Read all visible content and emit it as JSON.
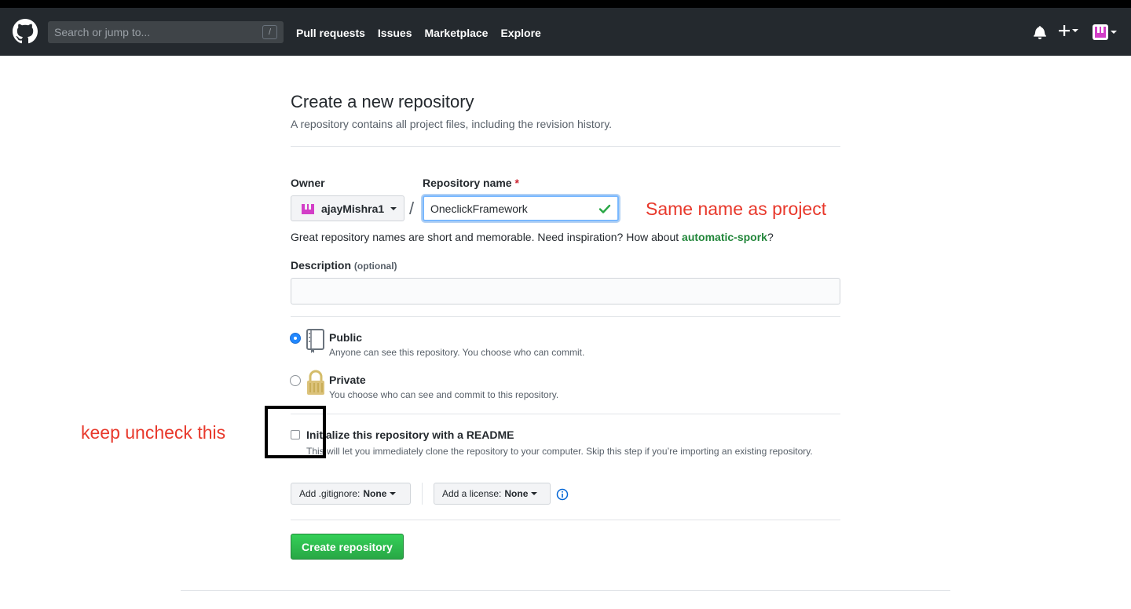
{
  "header": {
    "search_placeholder": "Search or jump to...",
    "search_shortcut": "/",
    "nav": [
      "Pull requests",
      "Issues",
      "Marketplace",
      "Explore"
    ],
    "plus_label": "+"
  },
  "page": {
    "title": "Create a new repository",
    "subtitle": "A repository contains all project files, including the revision history."
  },
  "form": {
    "owner_label": "Owner",
    "owner_value": "ajayMishra1",
    "slash": "/",
    "repo_label": "Repository name",
    "required_mark": "*",
    "repo_value": "OneclickFramework",
    "hint_prefix": "Great repository names are short and memorable. Need inspiration? How about",
    "hint_suggestion": "automatic-spork",
    "hint_suffix": "?",
    "description_label": "Description",
    "description_optional": "(optional)",
    "description_value": "",
    "visibility": [
      {
        "title": "Public",
        "desc": "Anyone can see this repository. You choose who can commit.",
        "selected": true
      },
      {
        "title": "Private",
        "desc": "You choose who can see and commit to this repository.",
        "selected": false
      }
    ],
    "readme_title": "Initialize this repository with a README",
    "readme_desc": "This will let you immediately clone the repository to your computer. Skip this step if you’re importing an existing repository.",
    "readme_checked": false,
    "gitignore_label": "Add .gitignore:",
    "gitignore_value": "None",
    "license_label": "Add a license:",
    "license_value": "None",
    "submit_label": "Create repository"
  },
  "annotations": {
    "repo_note": "Same name as project",
    "readme_note": "keep uncheck this"
  },
  "colors": {
    "header_bg": "#24292e",
    "primary_button": "#28a745",
    "annotation": "#e8382b",
    "focus": "#79b8ff",
    "suggestion": "#22863a"
  }
}
